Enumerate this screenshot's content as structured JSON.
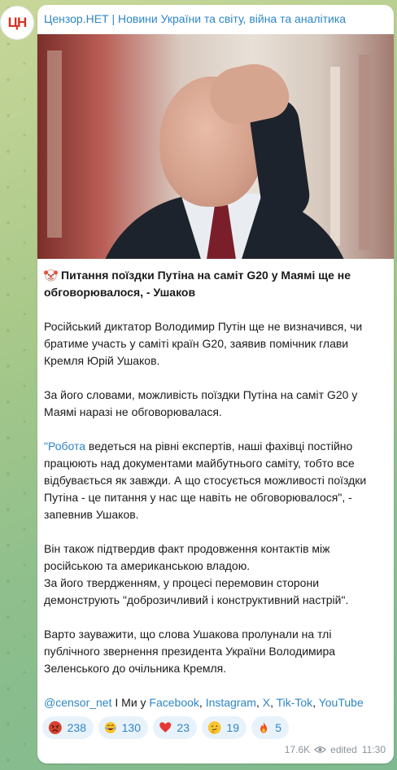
{
  "channel": {
    "avatar_text": "ЦН",
    "title": "Цензор.НЕТ | Новини України та світу, війна та аналітика"
  },
  "post": {
    "headline": "Питання поїздки Путіна на саміт G20 у Маямі ще не обговорювалося, - Ушаков",
    "paragraphs": [
      "Російський диктатор Володимир Путін ще не визначився, чи братиме участь у саміті країн G20, заявив помічник глави Кремля Юрій Ушаков.",
      "За його словами, можливість поїздки Путіна на саміт G20 у Маямі наразі не обговорювалася."
    ],
    "quote_link": "\"Робота",
    "quote_rest": " ведеться на рівні експертів, наші фахівці постійно працюють над документами майбутнього саміту, тобто все відбувається як завжди. А що стосується можливості поїздки Путіна - це питання у нас ще навіть не обговорювалося\", - запевнив Ушаков.",
    "paragraph4_line1": "Він також підтвердив факт продовження контактів між російською та американською владою.",
    "paragraph4_line2": "За його твердженням, у процесі перемовин сторони демонструють \"доброзичливий і конструктивний настрій\".",
    "paragraph5": "Варто зауважити, що слова Ушакова пролунали на тлі публічного звернення президента України Володимира Зеленського до очільника Кремля."
  },
  "footer_links": {
    "handle": "@censor_net",
    "middle": " І Ми у ",
    "facebook": "Facebook",
    "comma1": ", ",
    "instagram": "Instagram",
    "comma2": ", ",
    "x": "X",
    "comma3": ", ",
    "tiktok": "Tik-Tok",
    "comma4": ", ",
    "youtube": "YouTube"
  },
  "reactions": [
    {
      "emoji": "angry-face-icon",
      "count": "238"
    },
    {
      "emoji": "rofl-face-icon",
      "count": "130"
    },
    {
      "emoji": "heart-icon",
      "count": "23"
    },
    {
      "emoji": "thinking-face-icon",
      "count": "19"
    },
    {
      "emoji": "fire-icon",
      "count": "5"
    }
  ],
  "meta": {
    "views": "17.6K",
    "edited": "edited",
    "time": "11:30"
  },
  "colors": {
    "link": "#2e86c7",
    "reaction_bg": "#e8f2fb",
    "meta": "#8a939c"
  }
}
